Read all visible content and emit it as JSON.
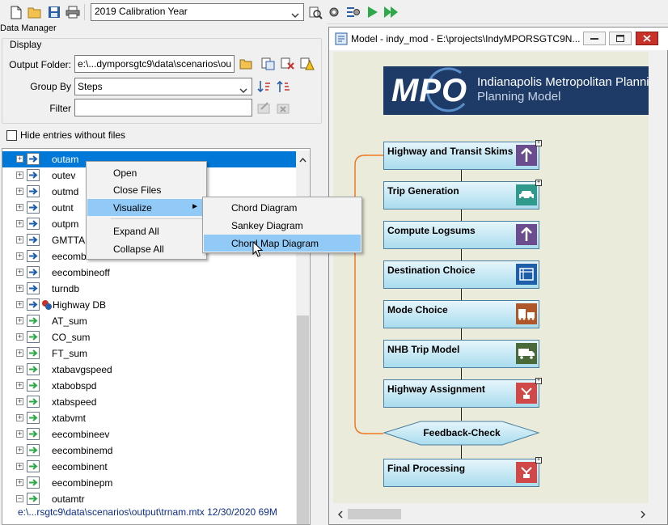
{
  "toolbar": {
    "calibration_year": "2019 Calibration Year",
    "icons": [
      "new-file-icon",
      "open-folder-icon",
      "save-icon",
      "print-icon",
      "zoom-icon",
      "settings-icon",
      "step-settings-icon",
      "run-icon",
      "run-all-icon"
    ]
  },
  "data_manager": {
    "title": "Data Manager",
    "display_label": "Display",
    "output_folder_label": "Output Folder:",
    "output_folder_value": "e:\\...dymporsgtc9\\data\\scenarios\\ou",
    "group_by_label": "Group By",
    "group_by_value": "Steps",
    "filter_label": "Filter",
    "filter_value": "",
    "hide_entries_label": "Hide entries without files",
    "tree_items": [
      {
        "label": "outam",
        "selected": true,
        "icon": "arrow-right-icon"
      },
      {
        "label": "outev",
        "icon": "arrow-right-icon"
      },
      {
        "label": "outmd",
        "icon": "arrow-right-icon"
      },
      {
        "label": "outnt",
        "icon": "arrow-right-icon"
      },
      {
        "label": "outpm",
        "icon": "arrow-right-icon"
      },
      {
        "label": "GMTTAB",
        "icon": "arrow-right-icon"
      },
      {
        "label": "eecomb",
        "icon": "arrow-right-icon"
      },
      {
        "label": "eecombineoff",
        "icon": "arrow-right-icon"
      },
      {
        "label": "turndb",
        "icon": "arrow-right-icon"
      },
      {
        "label": "Highway DB",
        "icon": "highway-db-icon"
      },
      {
        "label": "AT_sum",
        "icon": "green-arrow-icon"
      },
      {
        "label": "CO_sum",
        "icon": "green-arrow-icon"
      },
      {
        "label": "FT_sum",
        "icon": "green-arrow-icon"
      },
      {
        "label": "xtabavgspeed",
        "icon": "green-arrow-icon"
      },
      {
        "label": "xtabobspd",
        "icon": "green-arrow-icon"
      },
      {
        "label": "xtabspeed",
        "icon": "green-arrow-icon"
      },
      {
        "label": "xtabvmt",
        "icon": "green-arrow-icon"
      },
      {
        "label": "eecombineev",
        "icon": "green-arrow-icon"
      },
      {
        "label": "eecombinemd",
        "icon": "green-arrow-icon"
      },
      {
        "label": "eecombinent",
        "icon": "green-arrow-icon"
      },
      {
        "label": "eecombinepm",
        "icon": "green-arrow-icon"
      },
      {
        "label": "outamtr",
        "icon": "green-arrow-icon",
        "expanded": true
      }
    ],
    "file_line": "e:\\...rsgtc9\\data\\scenarios\\output\\trnam.mtx    12/30/2020  69M"
  },
  "context_menu": {
    "items": [
      "Open",
      "Close Files",
      "Visualize",
      "Expand All",
      "Collapse All"
    ],
    "highlighted": "Visualize",
    "submenu": [
      "Chord Diagram",
      "Sankey Diagram",
      "Chord Map Diagram"
    ],
    "submenu_highlighted": "Chord Map Diagram"
  },
  "model_window": {
    "title": "Model - indy_mod - E:\\projects\\IndyMPORSGTC9N...",
    "banner_logo": "MPO",
    "banner_line1": "Indianapolis Metropolitan Planning",
    "banner_line2": "Planning Model",
    "steps": [
      "Highway and Transit Skims",
      "Trip Generation",
      "Compute Logsums",
      "Destination Choice",
      "Mode Choice",
      "NHB Trip Model",
      "Highway Assignment"
    ],
    "feedback": "Feedback-Check",
    "final": "Final Processing",
    "colors": {
      "accent": "#0078d7",
      "step_top": "#e6f5fb",
      "step_bottom": "#a9dcee",
      "feedback_line": "#f07820"
    }
  }
}
